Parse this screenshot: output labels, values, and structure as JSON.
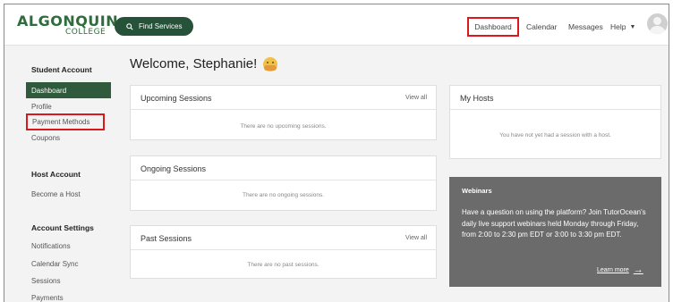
{
  "header": {
    "logo_top": "ALGONQUIN",
    "logo_bottom": "COLLEGE",
    "find_services": "Find Services",
    "nav": {
      "dashboard": "Dashboard",
      "calendar": "Calendar",
      "messages": "Messages",
      "help": "Help"
    }
  },
  "sidebar": {
    "student_heading": "Student Account",
    "student_items": [
      "Dashboard",
      "Profile",
      "Payment Methods",
      "Coupons"
    ],
    "host_heading": "Host Account",
    "host_items": [
      "Become a Host"
    ],
    "settings_heading": "Account Settings",
    "settings_items": [
      "Notifications",
      "Calendar Sync",
      "Sessions",
      "Payments"
    ]
  },
  "main": {
    "welcome": "Welcome, Stephanie!",
    "upcoming": {
      "title": "Upcoming Sessions",
      "link": "View all",
      "empty": "There are no upcoming sessions."
    },
    "ongoing": {
      "title": "Ongoing Sessions",
      "empty": "There are no ongoing sessions."
    },
    "past": {
      "title": "Past Sessions",
      "link": "View all",
      "empty": "There are no past sessions."
    },
    "hosts": {
      "title": "My Hosts",
      "empty": "You have not yet had a session with a host."
    },
    "webinars": {
      "title": "Webinars",
      "body": "Have a question on using the platform? Join TutorOcean's daily live support webinars held Monday through Friday, from 2:00 to 2:30 pm EDT or 3:00 to 3:30 pm EDT.",
      "link": "Learn more"
    }
  },
  "colors": {
    "brand_green": "#2f5a3b",
    "button_green": "#26523a",
    "highlight_red": "#d9191d",
    "webinar_bg": "#6b6b6b"
  },
  "icons": [
    "search-icon",
    "caret-down-icon",
    "avatar-icon",
    "emoji-icon",
    "arrow-right-icon"
  ]
}
